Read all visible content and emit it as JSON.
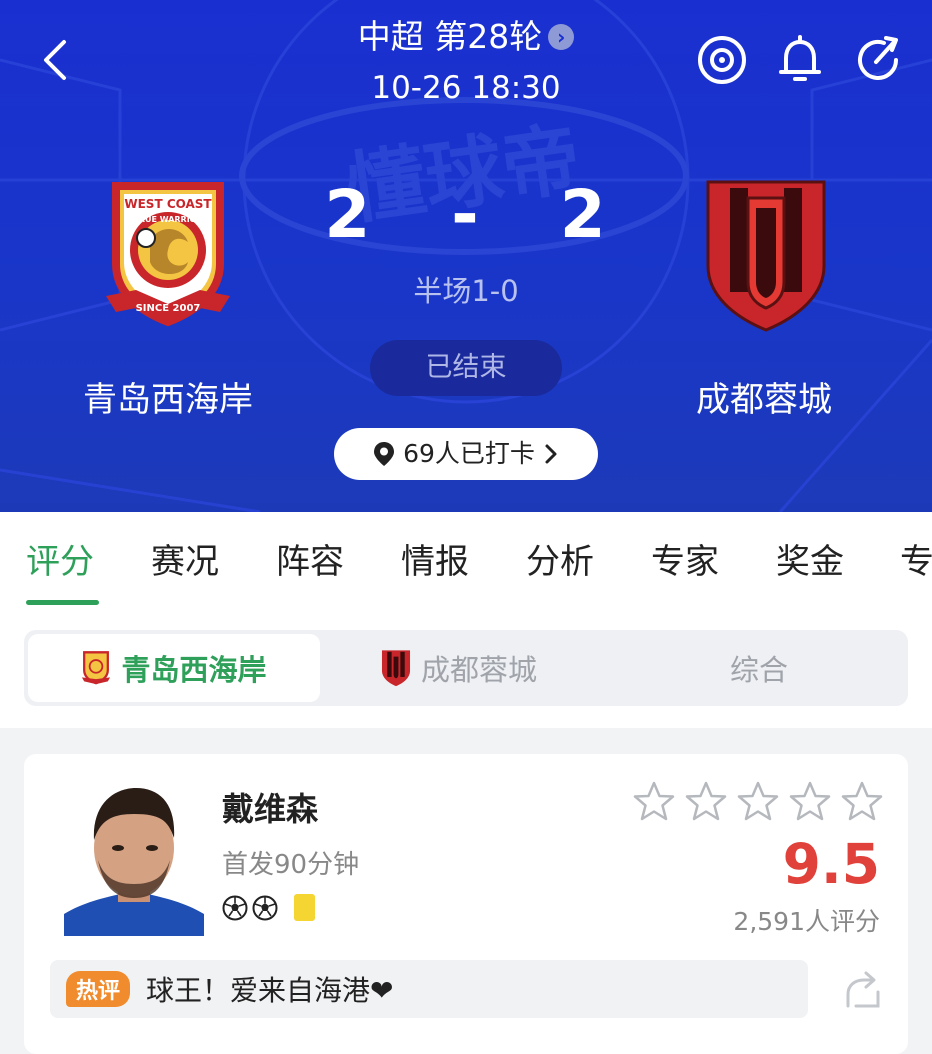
{
  "header": {
    "round": "中超 第28轮",
    "kickoff": "10-26 18:30",
    "score_home": "2",
    "score_sep": "-",
    "score_away": "2",
    "halftime": "半场1-0",
    "status": "已结束",
    "checkin": "69人已打卡",
    "watermark": "懂球帝",
    "home": {
      "name": "青岛西海岸",
      "logo_text_top": "WEST COAST",
      "logo_text_mid": "TRUE WARRIOR",
      "logo_text_bottom": "SINCE 2007"
    },
    "away": {
      "name": "成都蓉城"
    }
  },
  "icons": {
    "back": "back-arrow-icon",
    "target": "target-icon",
    "bell": "bell-icon",
    "share": "share-icon",
    "location": "location-pin-icon"
  },
  "tabs": [
    {
      "label": "评分",
      "active": true
    },
    {
      "label": "赛况"
    },
    {
      "label": "阵容"
    },
    {
      "label": "情报"
    },
    {
      "label": "分析"
    },
    {
      "label": "专家"
    },
    {
      "label": "奖金"
    },
    {
      "label": "专"
    }
  ],
  "team_switch": {
    "options": [
      {
        "label": "青岛西海岸",
        "active": true
      },
      {
        "label": "成都蓉城"
      },
      {
        "label": "综合"
      }
    ]
  },
  "player": {
    "name": "戴维森",
    "info": "首发90分钟",
    "goals": 2,
    "yellow_cards": 1,
    "stars_filled": 0,
    "stars_total": 5,
    "rating": "9.5",
    "votes": "2,591人评分",
    "hot_label": "热评",
    "comment": "球王！爱来自海港❤"
  },
  "colors": {
    "header_bg": "#1a2fd0",
    "accent_green": "#2fa05a",
    "rating_red": "#e0413a",
    "hot_orange": "#f08c2e",
    "away_red": "#c8262a"
  }
}
